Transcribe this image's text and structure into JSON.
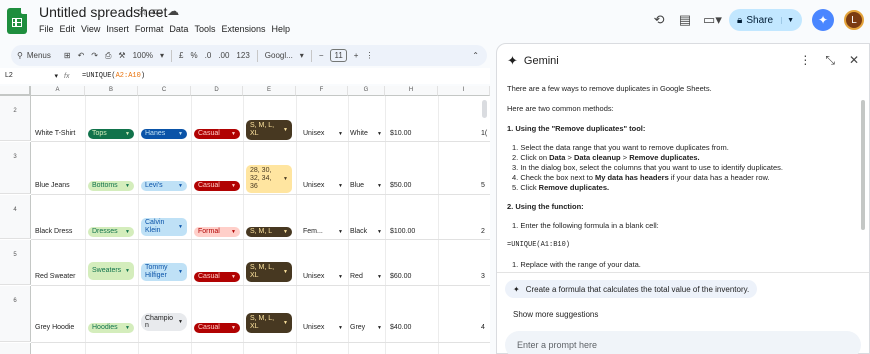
{
  "app": {
    "title": "Untitled spreadsheet",
    "menu": [
      "File",
      "Edit",
      "View",
      "Insert",
      "Format",
      "Data",
      "Tools",
      "Extensions",
      "Help"
    ],
    "share_label": "Share",
    "avatar_letter": "L"
  },
  "toolbar": {
    "search_label": "Menus",
    "zoom": "100%",
    "currency": "£",
    "percent": "%",
    "dec_less": ".0",
    "dec_more": ".00",
    "format_123": "123",
    "font": "Googl...",
    "font_size": "11"
  },
  "formula_bar": {
    "cell_ref": "L2",
    "formula_prefix": "=UNIQUE(",
    "formula_range": "A2:A10",
    "formula_suffix": ")"
  },
  "grid": {
    "columns": [
      "A",
      "B",
      "C",
      "D",
      "E",
      "F",
      "G",
      "H",
      "I"
    ],
    "rows": [
      {
        "num": "2",
        "name": "White T-Shirt",
        "category": "Tops",
        "brand": "Hanes",
        "style": "Casual",
        "sizes": "S, M, L, XL",
        "gender": "Unisex",
        "color": "White",
        "price": "$10.00",
        "extra": "1("
      },
      {
        "num": "3",
        "name": "Blue Jeans",
        "category": "Bottoms",
        "brand": "Levi's",
        "style": "Casual",
        "sizes": "28, 30, 32, 34, 36",
        "gender": "Unisex",
        "color": "Blue",
        "price": "$50.00",
        "extra": "5"
      },
      {
        "num": "4",
        "name": "Black Dress",
        "category": "Dresses",
        "brand": "Calvin Klein",
        "style": "Formal",
        "sizes": "S, M, L",
        "gender": "Fem...",
        "color": "Black",
        "price": "$100.00",
        "extra": "2"
      },
      {
        "num": "5",
        "name": "Red Sweater",
        "category": "Sweaters",
        "brand": "Tommy Hilfiger",
        "style": "Casual",
        "sizes": "S, M, L, XL",
        "gender": "Unisex",
        "color": "Red",
        "price": "$60.00",
        "extra": "3"
      },
      {
        "num": "6",
        "name": "Grey Hoodie",
        "category": "Hoodies",
        "brand": "Champion",
        "style": "Casual",
        "sizes": "S, M, L, XL",
        "gender": "Unisex",
        "color": "Grey",
        "price": "$40.00",
        "extra": "4"
      }
    ],
    "colors": {
      "tops_bg": "#11734b",
      "tops_fg": "#d4edbc",
      "hanes_bg": "#0a53a8",
      "hanes_fg": "#bfe1f6",
      "casual_bg": "#b10202",
      "casual_fg": "#ffcfc9",
      "sizes_bg": "#473821",
      "sizes_fg": "#ffe5a0",
      "bottoms_bg": "#d4edbc",
      "bottoms_fg": "#11734b",
      "levis_bg": "#bfe1f6",
      "levis_fg": "#0a53a8",
      "size_num_bg": "#ffe5a0",
      "size_num_fg": "#473821"
    }
  },
  "gemini": {
    "title": "Gemini",
    "intro": "There are a few ways to remove duplicates in Google Sheets.",
    "two_methods": "Here are two common methods:",
    "method1_heading": "1. Using the \"Remove duplicates\" tool:",
    "m1_step1": "1. Select the data range that you want to remove duplicates from.",
    "m1_step2_a": "2. Click on ",
    "m1_step2_b": "Data",
    "m1_step2_c": " > ",
    "m1_step2_d": "Data cleanup",
    "m1_step2_e": " > ",
    "m1_step2_f": "Remove duplicates.",
    "m1_step3": "3. In the dialog box, select the columns that you want to use to identify duplicates.",
    "m1_step4_a": "4. Check the box next to ",
    "m1_step4_b": "My data has headers",
    "m1_step4_c": " if your data has a header row.",
    "m1_step5_a": "5. Click ",
    "m1_step5_b": "Remove duplicates.",
    "method2_heading": "2. Using the  function:",
    "m2_step1": "1. Enter the following formula in a blank cell:",
    "m2_code": "=UNIQUE(A1:B10)",
    "m2_step2": "1. Replace  with the range of your data.",
    "suggestion": "Create a formula that calculates the total value of the inventory.",
    "more_suggestions": "Show more suggestions",
    "prompt_placeholder": "Enter a prompt here"
  }
}
